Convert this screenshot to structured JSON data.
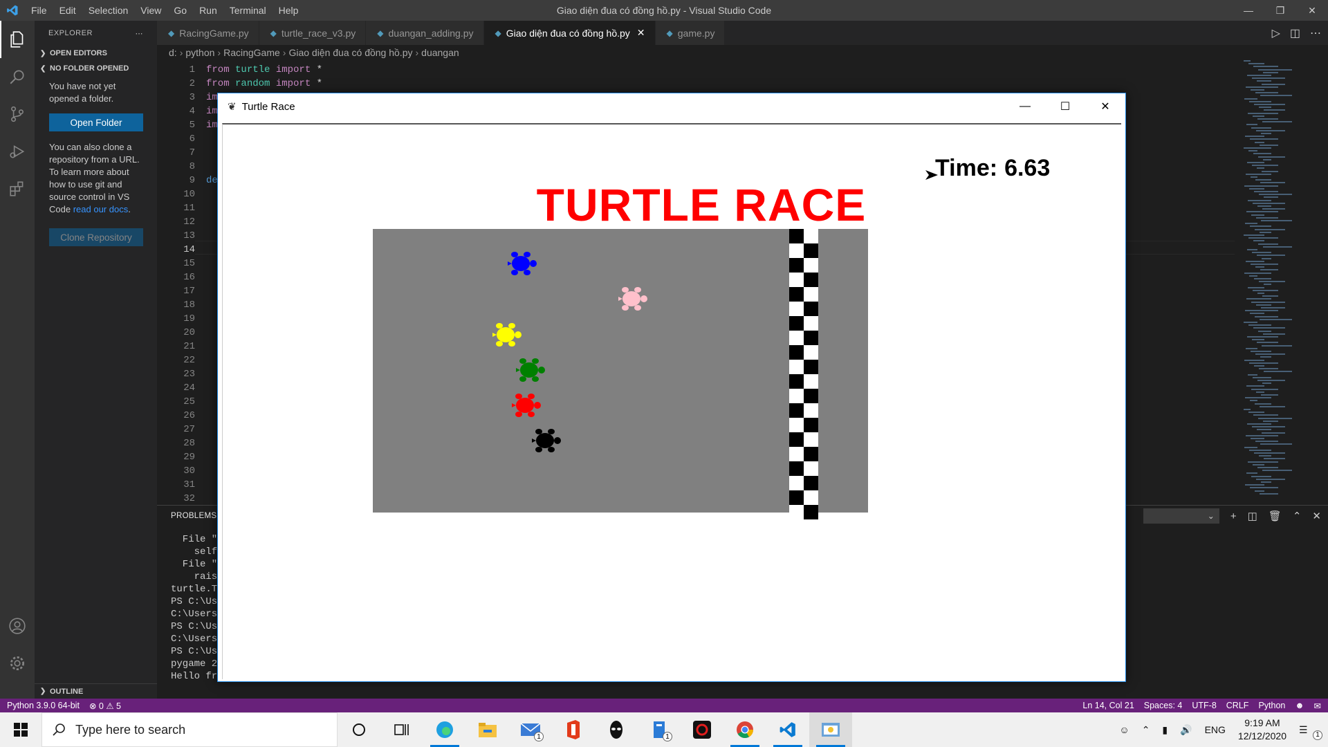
{
  "vscode": {
    "menu": [
      "File",
      "Edit",
      "Selection",
      "View",
      "Go",
      "Run",
      "Terminal",
      "Help"
    ],
    "window_title": "Giao diện đua có đồng hồ.py - Visual Studio Code",
    "sidebar": {
      "header": "EXPLORER",
      "open_editors": "OPEN EDITORS",
      "no_folder": "NO FOLDER OPENED",
      "msg1": "You have not yet opened a folder.",
      "open_folder": "Open Folder",
      "msg2": "You can also clone a repository from a URL. To learn more about how to use git and source control in VS Code",
      "docs_link": "read our docs",
      "clone": "Clone Repository",
      "outline": "OUTLINE"
    },
    "tabs": [
      "RacingGame.py",
      "turtle_race_v3.py",
      "duangan_adding.py",
      "Giao diện đua có đồng hồ.py",
      "game.py"
    ],
    "active_tab": 3,
    "breadcrumb": [
      "d:",
      "python",
      "RacingGame",
      "Giao diện đua có đồng hồ.py",
      "duangan"
    ],
    "code_lines": [
      {
        "kw1": "from",
        "mod": " turtle ",
        "kw2": "import",
        "rest": " *"
      },
      {
        "kw1": "from",
        "mod": " random ",
        "kw2": "import",
        "rest": " *"
      },
      {
        "kw1": "im",
        "mod": "",
        "kw2": "",
        "rest": ""
      },
      {
        "kw1": "im",
        "mod": "",
        "kw2": "",
        "rest": ""
      },
      {
        "kw1": "im",
        "mod": "",
        "kw2": "",
        "rest": ""
      }
    ],
    "line_numbers": [
      "1",
      "2",
      "3",
      "4",
      "5",
      "6",
      "7",
      "8",
      "9",
      "10",
      "11",
      "12",
      "13",
      "14",
      "15",
      "16",
      "17",
      "18",
      "19",
      "20",
      "21",
      "22",
      "23",
      "24",
      "25",
      "26",
      "27",
      "28",
      "29",
      "30",
      "31",
      "32"
    ],
    "def_fragment": "de",
    "panel_tab": "PROBLEMS",
    "terminal_lines": [
      "  File \"",
      "    self",
      "  File \"",
      "    rais",
      "turtle.T",
      "PS C:\\Us",
      "C:\\Users",
      "PS C:\\Us",
      "C:\\Users",
      "PS C:\\Us",
      "pygame 2",
      "Hello fr"
    ],
    "status": {
      "python": "Python 3.9.0 64-bit",
      "errors": "0",
      "warnings": "5",
      "position": "Ln 14, Col 21",
      "spaces": "Spaces: 4",
      "encoding": "UTF-8",
      "eol": "CRLF",
      "language": "Python"
    }
  },
  "turtle_window": {
    "title": "Turtle Race",
    "heading": "TURTLE RACE",
    "time_label": "Time:",
    "time_value": "6.63",
    "track_color": "#808080",
    "turtles": [
      {
        "color": "#0000ff",
        "name": "blue"
      },
      {
        "color": "#ffc0cb",
        "name": "pink"
      },
      {
        "color": "#ffff00",
        "name": "yellow"
      },
      {
        "color": "#008000",
        "name": "green"
      },
      {
        "color": "#ff0000",
        "name": "red"
      },
      {
        "color": "#000000",
        "name": "black"
      }
    ]
  },
  "taskbar": {
    "search_placeholder": "Type here to search",
    "mail_badge": "1",
    "files_badge": "1",
    "lang": "ENG",
    "time": "9:19 AM",
    "date": "12/12/2020",
    "notif_badge": "1"
  }
}
